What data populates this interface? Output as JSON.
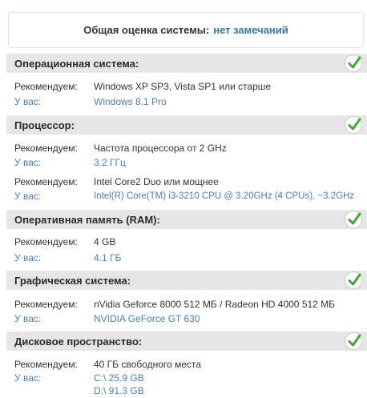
{
  "summary": {
    "label": "Общая оценка системы:",
    "value": "нет замечаний"
  },
  "sections": [
    {
      "title": "Операционная система:",
      "rows": [
        {
          "label": "Рекомендуем:",
          "value": "Windows XP SP3, Vista SP1 или старше"
        },
        {
          "label": "У вас:",
          "value": "Windows 8.1 Pro"
        }
      ]
    },
    {
      "title": "Процессор:",
      "rows": [
        {
          "label": "Рекомендуем:",
          "value": "Частота процессора от 2 GHz"
        },
        {
          "label": "У вас:",
          "value": "3.2 ГГц"
        },
        {
          "label": "Рекомендуем:",
          "value": "Intel Core2 Duo или мощнее"
        },
        {
          "label": "У вас:",
          "value": "Intel(R) Core(TM) i3-3210 CPU @ 3.20GHz (4 CPUs), ~3.2GHz"
        }
      ]
    },
    {
      "title": "Оперативная память (RAM):",
      "rows": [
        {
          "label": "Рекомендуем:",
          "value": "4 GB"
        },
        {
          "label": "У вас:",
          "value": "4.1 ГБ"
        }
      ]
    },
    {
      "title": "Графическая система:",
      "rows": [
        {
          "label": "Рекомендуем:",
          "value": "nVidia Geforce 8000 512 МБ / Radeon HD 4000 512 МБ"
        },
        {
          "label": "У вас:",
          "value": "NVIDIA GeForce GT 630"
        }
      ]
    },
    {
      "title": "Дисковое пространство:",
      "rows": [
        {
          "label": "Рекомендуем:",
          "value": "40 ГБ свободного места"
        },
        {
          "label": "У вас:",
          "value": "C:\\  25.9 GB"
        },
        {
          "label": "",
          "value": "D:\\  91.3 GB"
        }
      ]
    }
  ],
  "icons": {
    "status": "checkmark-icon"
  },
  "colors": {
    "accent": "#4b7fb0",
    "check": "#3cab2f",
    "header_bg": "#e6e6e6"
  }
}
